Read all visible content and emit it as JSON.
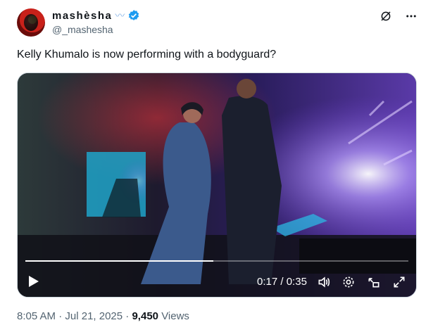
{
  "author": {
    "display_name": "mashèsha",
    "handle": "@_mashesha",
    "verified": true
  },
  "tweet": {
    "text": "Kelly Khumalo is now performing with a bodyguard?"
  },
  "video": {
    "current_time": "0:17",
    "separator": "/",
    "duration": "0:35",
    "progress_fraction": 0.49
  },
  "meta": {
    "time": "8:05 AM",
    "dot": "·",
    "date": "Jul 21, 2025",
    "dot2": "·",
    "views_count": "9,450",
    "views_label": "Views"
  },
  "icons": {
    "top_right": [
      "grok-icon",
      "more-icon"
    ],
    "controls": [
      "play-icon",
      "volume-icon",
      "settings-icon",
      "picture-in-picture-icon",
      "fullscreen-icon"
    ]
  },
  "colors": {
    "verified_blue": "#1d9bf0",
    "secondary_text": "#536471"
  }
}
